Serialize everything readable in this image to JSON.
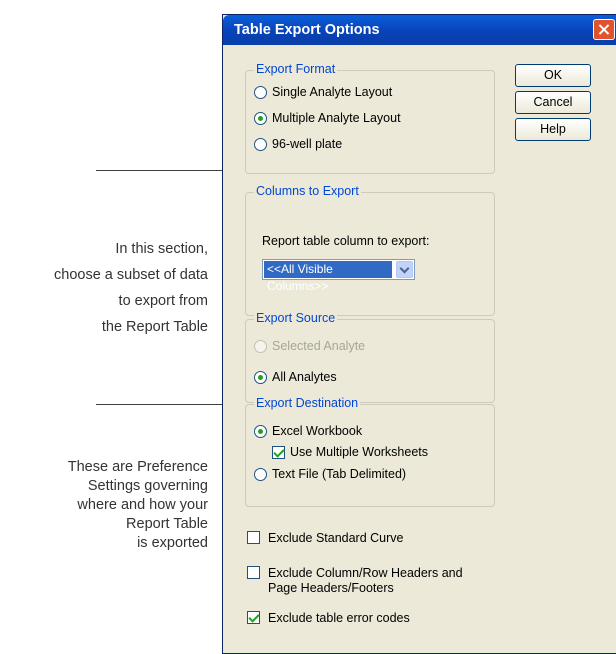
{
  "annotations": {
    "columns_note": [
      "In this section,",
      "choose a subset of data",
      "to export from",
      "the Report Table"
    ],
    "preferences_note": [
      "These are Preference",
      "Settings governing",
      "where and how your",
      "Report Table",
      "is exported"
    ]
  },
  "dialog": {
    "title": "Table Export Options",
    "buttons": {
      "ok": "OK",
      "cancel": "Cancel",
      "help": "Help"
    },
    "export_format": {
      "title": "Export Format",
      "options": [
        "Single Analyte Layout",
        "Multiple Analyte Layout",
        "96-well plate"
      ],
      "selected": "Multiple Analyte Layout"
    },
    "columns_to_export": {
      "title": "Columns to Export",
      "label": "Report table column to export:",
      "selected_value": "<<All Visible Columns>>"
    },
    "export_source": {
      "title": "Export Source",
      "options": [
        "Selected Analyte",
        "All Analytes"
      ],
      "selected": "All Analytes",
      "disabled": [
        "Selected Analyte"
      ]
    },
    "export_destination": {
      "title": "Export Destination",
      "excel": "Excel Workbook",
      "use_multiple_worksheets": "Use Multiple Worksheets",
      "use_multiple_worksheets_checked": true,
      "text_file": "Text File (Tab Delimited)",
      "selected": "Excel Workbook"
    },
    "options": [
      {
        "label": "Exclude Standard Curve",
        "checked": false
      },
      {
        "label": "Exclude Column/Row Headers and",
        "label2": "Page Headers/Footers",
        "checked": false
      },
      {
        "label": "Exclude table error codes",
        "checked": true
      }
    ]
  }
}
